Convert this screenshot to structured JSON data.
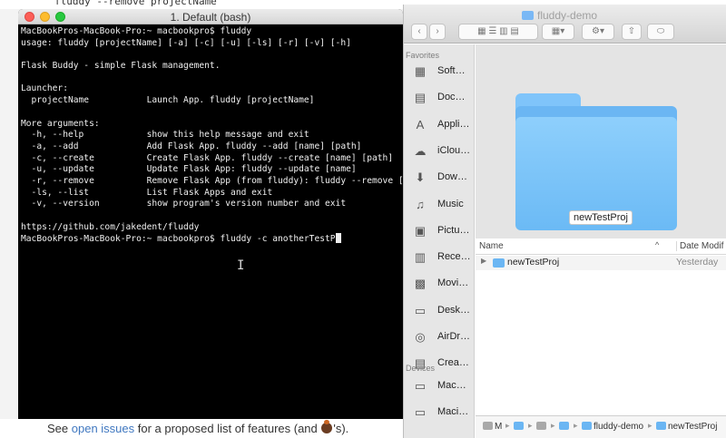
{
  "background_page": {
    "top_text": "fluddy --remove projectName",
    "bottom_prefix": "See ",
    "bottom_link": "open issues",
    "bottom_suffix": " for a proposed list of features (and ",
    "bottom_end": "'s).",
    "bug_icon": "bug-icon"
  },
  "terminal": {
    "title": "1. Default (bash)",
    "lines": [
      "MacBookPros-MacBook-Pro:~ macbookpro$ fluddy",
      "usage: fluddy [projectName] [-a] [-c] [-u] [-ls] [-r] [-v] [-h]",
      "",
      "Flask Buddy - simple Flask management.",
      "",
      "Launcher:",
      "  projectName           Launch App. fluddy [projectName]",
      "",
      "More arguments:",
      "  -h, --help            show this help message and exit",
      "  -a, --add             Add Flask App. fluddy --add [name] [path]",
      "  -c, --create          Create Flask App. fluddy --create [name] [path]",
      "  -u, --update          Update Flask App: fluddy --update [name]",
      "  -r, --remove          Remove Flask App (from fluddy): fluddy --remove [name]",
      "  -ls, --list           List Flask Apps and exit",
      "  -v, --version         show program's version number and exit",
      "",
      "https://github.com/jakedent/fluddy"
    ],
    "prompt_line": "MacBookPros-MacBook-Pro:~ macbookpro$ fluddy -c anotherTestP"
  },
  "finder": {
    "title": "fluddy-demo",
    "sidebar": {
      "favorites_header": "Favorites",
      "devices_header": "Devices",
      "favorites": [
        {
          "label": "Soft…",
          "icon": "applications-dock-icon"
        },
        {
          "label": "Doc…",
          "icon": "documents-icon"
        },
        {
          "label": "Appli…",
          "icon": "applications-icon"
        },
        {
          "label": "iClou…",
          "icon": "icloud-icon"
        },
        {
          "label": "Dow…",
          "icon": "downloads-icon"
        },
        {
          "label": "Music",
          "icon": "music-icon"
        },
        {
          "label": "Pictu…",
          "icon": "pictures-icon"
        },
        {
          "label": "Rece…",
          "icon": "recents-icon"
        },
        {
          "label": "Movi…",
          "icon": "movies-icon"
        },
        {
          "label": "Desk…",
          "icon": "desktop-icon"
        },
        {
          "label": "AirDr…",
          "icon": "airdrop-icon"
        },
        {
          "label": "Crea…",
          "icon": "creative-cloud-icon"
        }
      ],
      "devices": [
        {
          "label": "Mac…",
          "icon": "hard-drive-icon"
        },
        {
          "label": "Maci…",
          "icon": "hard-drive-icon"
        }
      ]
    },
    "preview_folder_name": "newTestProj",
    "list": {
      "col_name": "Name",
      "col_sort": "^",
      "col_date": "Date Modif",
      "rows": [
        {
          "name": "newTestProj",
          "date": "Yesterday"
        }
      ]
    },
    "pathbar": [
      "M",
      "",
      "",
      "",
      "fluddy-demo",
      "newTestProj"
    ]
  }
}
